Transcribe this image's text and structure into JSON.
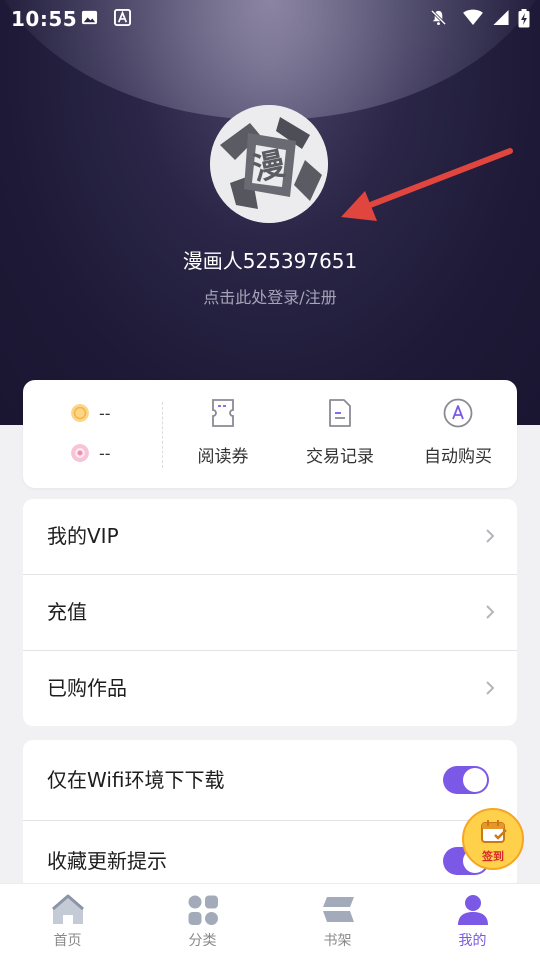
{
  "status_bar": {
    "time": "10:55"
  },
  "profile": {
    "username": "漫画人525397651",
    "login_hint": "点击此处登录/注册"
  },
  "wallet": {
    "coins": "--",
    "gems": "--"
  },
  "quick_actions": [
    {
      "label": "阅读券",
      "icon": "ticket-icon"
    },
    {
      "label": "交易记录",
      "icon": "document-icon"
    },
    {
      "label": "自动购买",
      "icon": "auto-buy-icon"
    }
  ],
  "menu": [
    {
      "label": "我的VIP"
    },
    {
      "label": "充值"
    },
    {
      "label": "已购作品"
    }
  ],
  "settings": [
    {
      "label": "仅在Wifi环境下下载",
      "enabled": true
    },
    {
      "label": "收藏更新提示",
      "enabled": true
    }
  ],
  "checkin": {
    "label": "签到"
  },
  "bottom_nav": [
    {
      "label": "首页",
      "icon": "home-icon"
    },
    {
      "label": "分类",
      "icon": "category-icon"
    },
    {
      "label": "书架",
      "icon": "bookshelf-icon"
    },
    {
      "label": "我的",
      "icon": "profile-icon",
      "active": true
    }
  ],
  "colors": {
    "accent": "#7b59e6",
    "header_bg": "#1d1936",
    "page_bg": "#f1f1f3"
  }
}
